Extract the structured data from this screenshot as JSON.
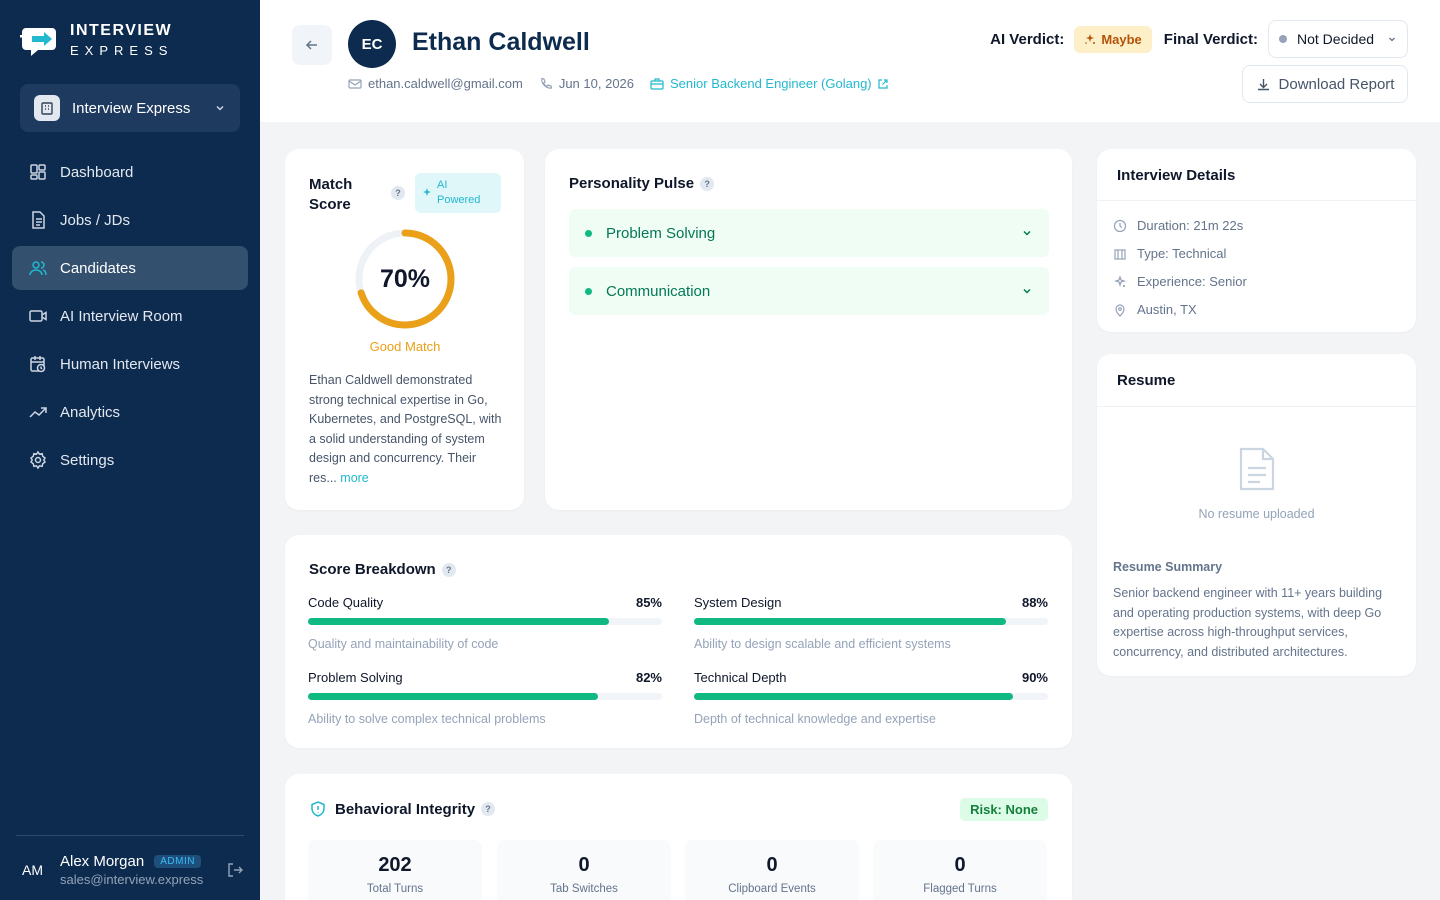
{
  "brand": {
    "line1": "INTERVIEW",
    "line2": "EXPRESS"
  },
  "org_switcher": {
    "label": "Interview Express"
  },
  "nav": [
    {
      "label": "Dashboard",
      "icon": "dashboard-icon"
    },
    {
      "label": "Jobs / JDs",
      "icon": "document-icon"
    },
    {
      "label": "Candidates",
      "icon": "users-icon",
      "active": true
    },
    {
      "label": "AI Interview Room",
      "icon": "video-icon"
    },
    {
      "label": "Human Interviews",
      "icon": "calendar-icon"
    },
    {
      "label": "Analytics",
      "icon": "trend-icon"
    },
    {
      "label": "Settings",
      "icon": "gear-icon"
    }
  ],
  "user": {
    "initials": "AM",
    "name": "Alex Morgan",
    "role": "ADMIN",
    "email": "sales@interview.express"
  },
  "candidate": {
    "initials": "EC",
    "name": "Ethan Caldwell",
    "email": "ethan.caldwell@gmail.com",
    "date": "Jun 10, 2026",
    "job": "Senior Backend Engineer (Golang)"
  },
  "verdict": {
    "ai_label": "AI Verdict:",
    "ai_value": "Maybe",
    "final_label": "Final Verdict:",
    "final_value": "Not Decided",
    "download_label": "Download Report"
  },
  "match": {
    "title": "Match Score",
    "ai_badge": "AI Powered",
    "percent": 70,
    "percent_text": "70%",
    "rating": "Good Match",
    "summary": "Ethan Caldwell demonstrated strong technical expertise in Go, Kubernetes, and PostgreSQL, with a solid understanding of system design and concurrency. Their res...",
    "more": "more"
  },
  "personality": {
    "title": "Personality Pulse",
    "items": [
      "Problem Solving",
      "Communication"
    ]
  },
  "details": {
    "title": "Interview Details",
    "items": [
      {
        "text": "Duration: 21m 22s",
        "icon": "clock-icon"
      },
      {
        "text": "Type: Technical",
        "icon": "building-icon"
      },
      {
        "text": "Experience: Senior",
        "icon": "sparkle-icon"
      },
      {
        "text": "Austin, TX",
        "icon": "location-icon"
      }
    ]
  },
  "resume": {
    "title": "Resume",
    "empty": "No resume uploaded",
    "summary_title": "Resume Summary",
    "summary": "Senior backend engineer with 11+ years building and operating production systems, with deep Go expertise across high-throughput services, concurrency, and distributed architectures."
  },
  "breakdown": {
    "title": "Score Breakdown",
    "metrics": [
      {
        "name": "Code Quality",
        "value": 85,
        "label": "85%",
        "desc": "Quality and maintainability of code"
      },
      {
        "name": "System Design",
        "value": 88,
        "label": "88%",
        "desc": "Ability to design scalable and efficient systems"
      },
      {
        "name": "Problem Solving",
        "value": 82,
        "label": "82%",
        "desc": "Ability to solve complex technical problems"
      },
      {
        "name": "Technical Depth",
        "value": 90,
        "label": "90%",
        "desc": "Depth of technical knowledge and expertise"
      }
    ]
  },
  "integrity": {
    "title": "Behavioral Integrity",
    "risk": "Risk: None",
    "stats": [
      {
        "value": "202",
        "label": "Total Turns"
      },
      {
        "value": "0",
        "label": "Tab Switches"
      },
      {
        "value": "0",
        "label": "Clipboard Events"
      },
      {
        "value": "0",
        "label": "Flagged Turns"
      }
    ]
  },
  "colors": {
    "sidebar": "#0d2b4e",
    "accent": "#22b8cf",
    "success": "#10b981",
    "warning": "#eaa018"
  }
}
